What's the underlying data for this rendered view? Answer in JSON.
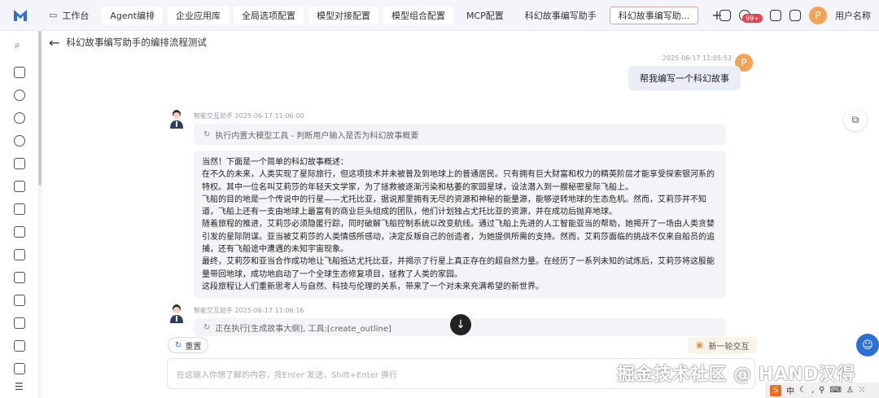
{
  "tabs": [
    {
      "label": "工作台",
      "icon": "monitor-icon",
      "style": "plain"
    },
    {
      "label": "Agent编排",
      "style": "box"
    },
    {
      "label": "企业应用库",
      "style": "box"
    },
    {
      "label": "全局选项配置",
      "style": "box"
    },
    {
      "label": "模型对接配置",
      "style": "box"
    },
    {
      "label": "模型组合配置",
      "style": "box"
    },
    {
      "label": "MCP配置",
      "style": "plain"
    },
    {
      "label": "科幻故事编写助手",
      "style": "plain"
    },
    {
      "label": "科幻故事编写助...",
      "style": "active"
    }
  ],
  "header": {
    "notification_badge": "99+",
    "avatar_letter": "P",
    "username": "用户名称"
  },
  "page": {
    "title": "科幻故事编写助手的编排流程测试"
  },
  "chat": {
    "user_message": {
      "time": "2025-06-17 11:05:53",
      "avatar_letter": "P",
      "text": "帮我编写一个科幻故事"
    },
    "bot_message_1": {
      "name": "智能交互助手",
      "time": "2025-06-17 11:06:00",
      "tool_text": "执行内置大模型工具 - 判断用户输入是否为科幻故事概要",
      "answer_lines": [
        "当然！下面是一个简单的科幻故事概述：",
        "在不久的未来，人类实现了星际旅行，但这项技术并未被普及到地球上的普通居民。只有拥有巨大财富和权力的精英阶层才能享受探索银河系的特权。其中一位名叫艾莉莎的年轻天文学家，为了拯救被逐渐污染和枯萎的家园星球，设法潜入到一艘秘密星际飞船上。",
        "飞船的目的地是一个传说中的行星——尤托比亚，据说那里拥有无尽的资源和神秘的能量源，能够逆转地球的生态危机。然而，艾莉莎并不知道，飞船上还有一支由地球上最富有的商业巨头组成的团队，他们计划独占尤托比亚的资源，并在成功后抛弃地球。",
        "随着旅程的推进，艾莉莎必须隐匿行踪，同时破解飞船控制系统以改变航线。通过飞船上先进的人工智能亚当的帮助，她揭开了一场由人类贪婪引发的星际阴谋。亚当被艾莉莎的人类情感所感动，决定反叛自己的创造者，为她提供所需的支持。然而，艾莉莎面临的挑战不仅来自船员的追捕，还有飞船途中遭遇的未知宇宙现象。",
        "最终，艾莉莎和亚当合作成功地让飞船抵达尤托比亚，并揭示了行星上真正存在的超自然力量。在经历了一系列未知的试炼后，艾莉莎将这股能量带回地球，成功地启动了一个全球生态修复项目，拯救了人类的家园。",
        "这段旅程让人们重新思考人与自然、科技与伦理的关系，带来了一个对未来充满希望的新世界。"
      ]
    },
    "bot_message_2": {
      "name": "智能交互助手",
      "time": "2025-06-17 11:06:16",
      "tool_text": "正在执行[生成故事大纲], 工具:[create_outline]"
    }
  },
  "controls": {
    "reset_label": "重置",
    "new_round_label": "新一轮交互",
    "input_placeholder": "在这输入你想了解的内容，按Enter 发送，Shift+Enter 换行"
  },
  "watermark": "掘金技术社区 @ HAND汉得",
  "ime": {
    "logo": "S",
    "lang": "中"
  },
  "colors": {
    "accent": "#2a6fd6",
    "avatar_orange": "#f5a352",
    "badge_red": "#e9424f"
  }
}
